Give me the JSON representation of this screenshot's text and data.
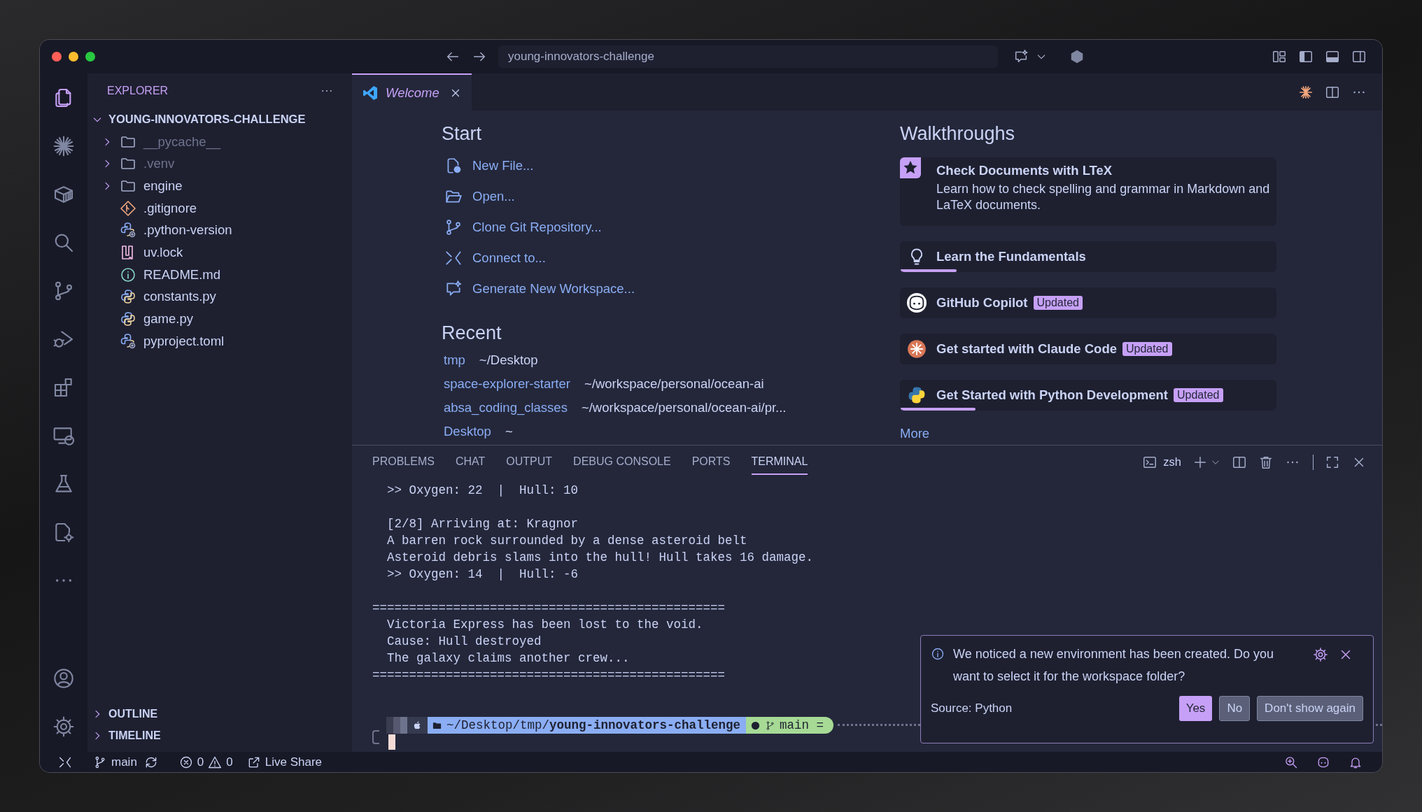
{
  "title_bar": {
    "search": "young-innovators-challenge"
  },
  "activity_bar": [
    {
      "kind": "files",
      "selected": true
    },
    {
      "kind": "sparkle",
      "selected": false
    },
    {
      "kind": "package",
      "selected": false
    },
    {
      "kind": "search",
      "selected": false
    },
    {
      "kind": "branch",
      "selected": false
    },
    {
      "kind": "debug",
      "selected": false
    },
    {
      "kind": "extensions",
      "selected": false
    },
    {
      "kind": "remote",
      "selected": false
    },
    {
      "kind": "flask",
      "selected": false
    },
    {
      "kind": "config",
      "selected": false
    },
    {
      "kind": "more",
      "selected": false
    }
  ],
  "sidebar": {
    "title": "EXPLORER",
    "root": {
      "name": "YOUNG-INNOVATORS-CHALLENGE",
      "expanded": true,
      "children": [
        {
          "name": "__pycache__",
          "kind": "folder",
          "expanded": false,
          "ignored": true
        },
        {
          "name": ".venv",
          "kind": "folder",
          "expanded": false,
          "ignored": true
        },
        {
          "name": "engine",
          "kind": "folder",
          "expanded": false,
          "ignored": false
        },
        {
          "name": ".gitignore",
          "kind": "git",
          "ignored": false
        },
        {
          "name": ".python-version",
          "kind": "python-config",
          "ignored": false
        },
        {
          "name": "uv.lock",
          "kind": "uv",
          "ignored": false
        },
        {
          "name": "README.md",
          "kind": "info",
          "ignored": false
        },
        {
          "name": "constants.py",
          "kind": "python",
          "ignored": false
        },
        {
          "name": "game.py",
          "kind": "python",
          "ignored": false
        },
        {
          "name": "pyproject.toml",
          "kind": "python-config",
          "ignored": false
        }
      ]
    },
    "sections": [
      {
        "name": "OUTLINE",
        "expanded": false
      },
      {
        "name": "TIMELINE",
        "expanded": false
      }
    ]
  },
  "tabs": [
    {
      "label": "Welcome",
      "selected": true
    }
  ],
  "welcome": {
    "start_title": "Start",
    "start": [
      {
        "label": "New File...",
        "kind": "new-file"
      },
      {
        "label": "Open...",
        "kind": "folder-open"
      },
      {
        "label": "Clone Git Repository...",
        "kind": "branch"
      },
      {
        "label": "Connect to...",
        "kind": "remote"
      },
      {
        "label": "Generate New Workspace...",
        "kind": "chat"
      }
    ],
    "recent_title": "Recent",
    "recent": [
      {
        "name": "tmp",
        "path": "~/Desktop"
      },
      {
        "name": "space-explorer-starter",
        "path": "~/workspace/personal/ocean-ai"
      },
      {
        "name": "absa_coding_classes",
        "path": "~/workspace/personal/ocean-ai/pr..."
      },
      {
        "name": "Desktop",
        "path": "~"
      }
    ],
    "walkthroughs_title": "Walkthroughs",
    "walkthroughs": [
      {
        "title": "Check Documents with LTeX",
        "description": "Learn how to check spelling and grammar in Markdown and LaTeX documents.",
        "kind": "star"
      },
      {
        "title": "Learn the Fundamentals",
        "kind": "bulb",
        "level": 0.15
      },
      {
        "title": "GitHub Copilot",
        "badge": "Updated",
        "kind": "copilot"
      },
      {
        "title": "Get started with Claude Code",
        "badge": "Updated",
        "kind": "claude"
      },
      {
        "title": "Get Started with Python Development",
        "badge": "Updated",
        "kind": "python",
        "level": 0.2
      }
    ],
    "more": "More"
  },
  "panel": {
    "tabs": [
      {
        "label": "PROBLEMS",
        "selected": false
      },
      {
        "label": "CHAT",
        "selected": false
      },
      {
        "label": "OUTPUT",
        "selected": false
      },
      {
        "label": "DEBUG CONSOLE",
        "selected": false
      },
      {
        "label": "PORTS",
        "selected": false
      },
      {
        "label": "TERMINAL",
        "selected": true
      }
    ],
    "shell": "zsh",
    "terminal": {
      "blocks": [
        [
          "  >> Oxygen: 22  |  Hull: 10"
        ],
        [
          "  [2/8] Arriving at: Kragnor",
          "  A barren rock surrounded by a dense asteroid belt",
          "  Asteroid debris slams into the hull! Hull takes 16 damage.",
          "  >> Oxygen: 14  |  Hull: -6"
        ],
        [
          "================================================",
          "  Victoria Express has been lost to the void.",
          "  Cause: Hull destroyed",
          "  The galaxy claims another crew...",
          "================================================"
        ]
      ],
      "prompt": {
        "path": "~/Desktop/tmp/**young-innovators-challenge**",
        "branch": "main ="
      }
    }
  },
  "notification": {
    "message": "We noticed a new environment has been created. Do you want to select it for the workspace folder?",
    "source": "Source: Python",
    "buttons": [
      {
        "label": "Yes",
        "kind": "primary"
      },
      {
        "label": "No",
        "kind": "secondary"
      },
      {
        "label": "Don't show again",
        "kind": "secondary"
      }
    ]
  },
  "status_bar": {
    "branch": "main",
    "errors": "0",
    "warnings": "0",
    "live_share": "Live Share"
  }
}
